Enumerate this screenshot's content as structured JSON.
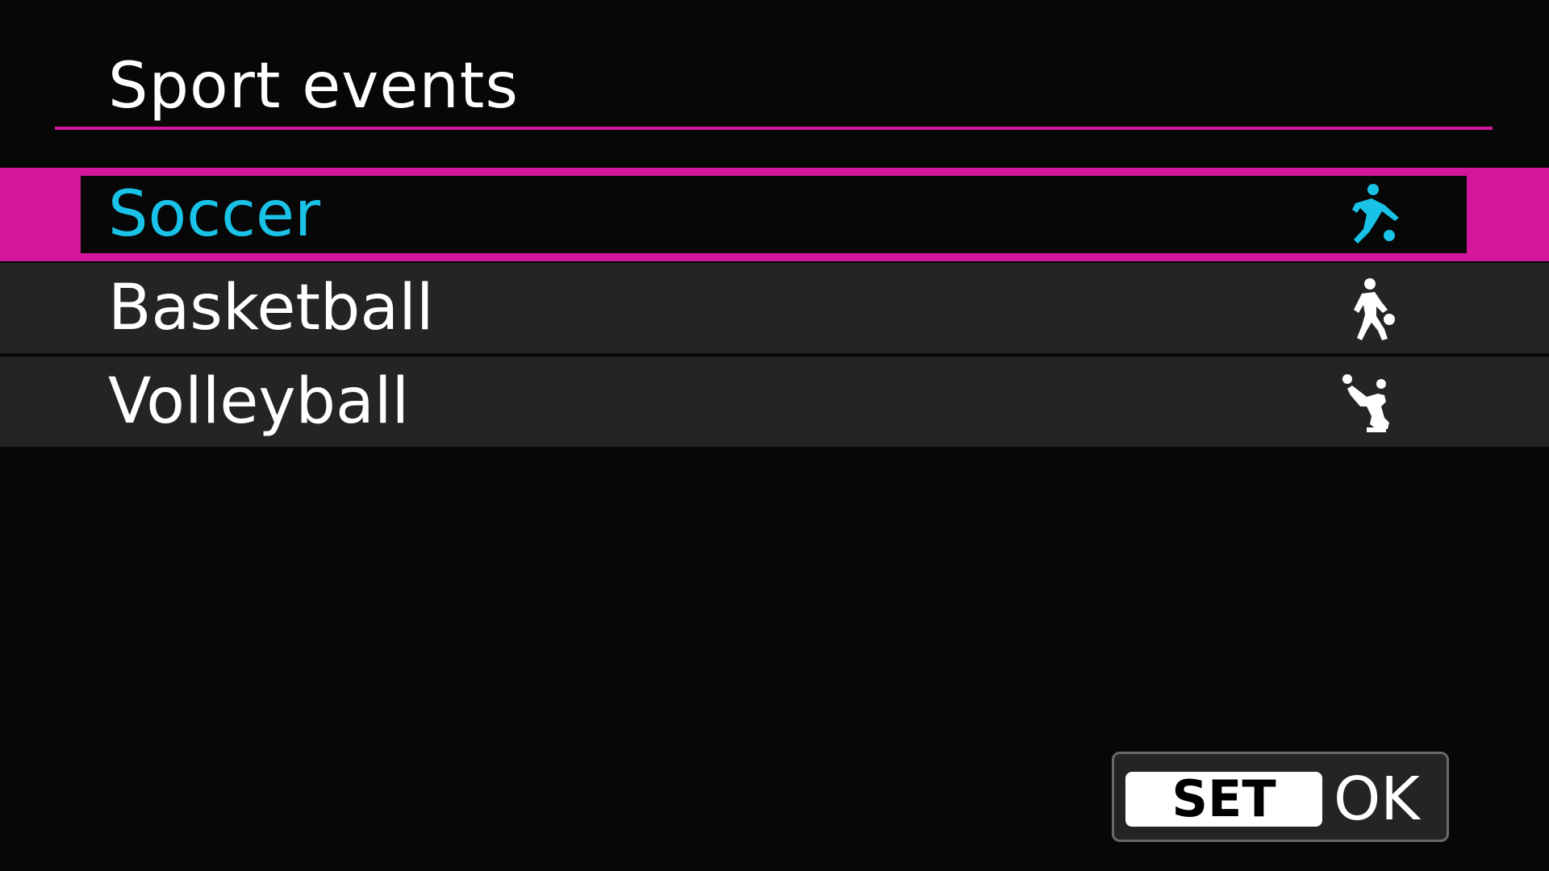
{
  "colors": {
    "accent": "#d4169c",
    "selected_text": "#19c3e8",
    "text": "#ffffff",
    "background": "#070707",
    "row_background": "#242424"
  },
  "header": {
    "title": "Sport events"
  },
  "menu": {
    "items": [
      {
        "label": "Soccer",
        "icon": "soccer-player-icon",
        "selected": true
      },
      {
        "label": "Basketball",
        "icon": "basketball-player-icon",
        "selected": false
      },
      {
        "label": "Volleyball",
        "icon": "volleyball-player-icon",
        "selected": false
      }
    ]
  },
  "footer": {
    "set_label": "SET",
    "ok_label": "OK"
  }
}
